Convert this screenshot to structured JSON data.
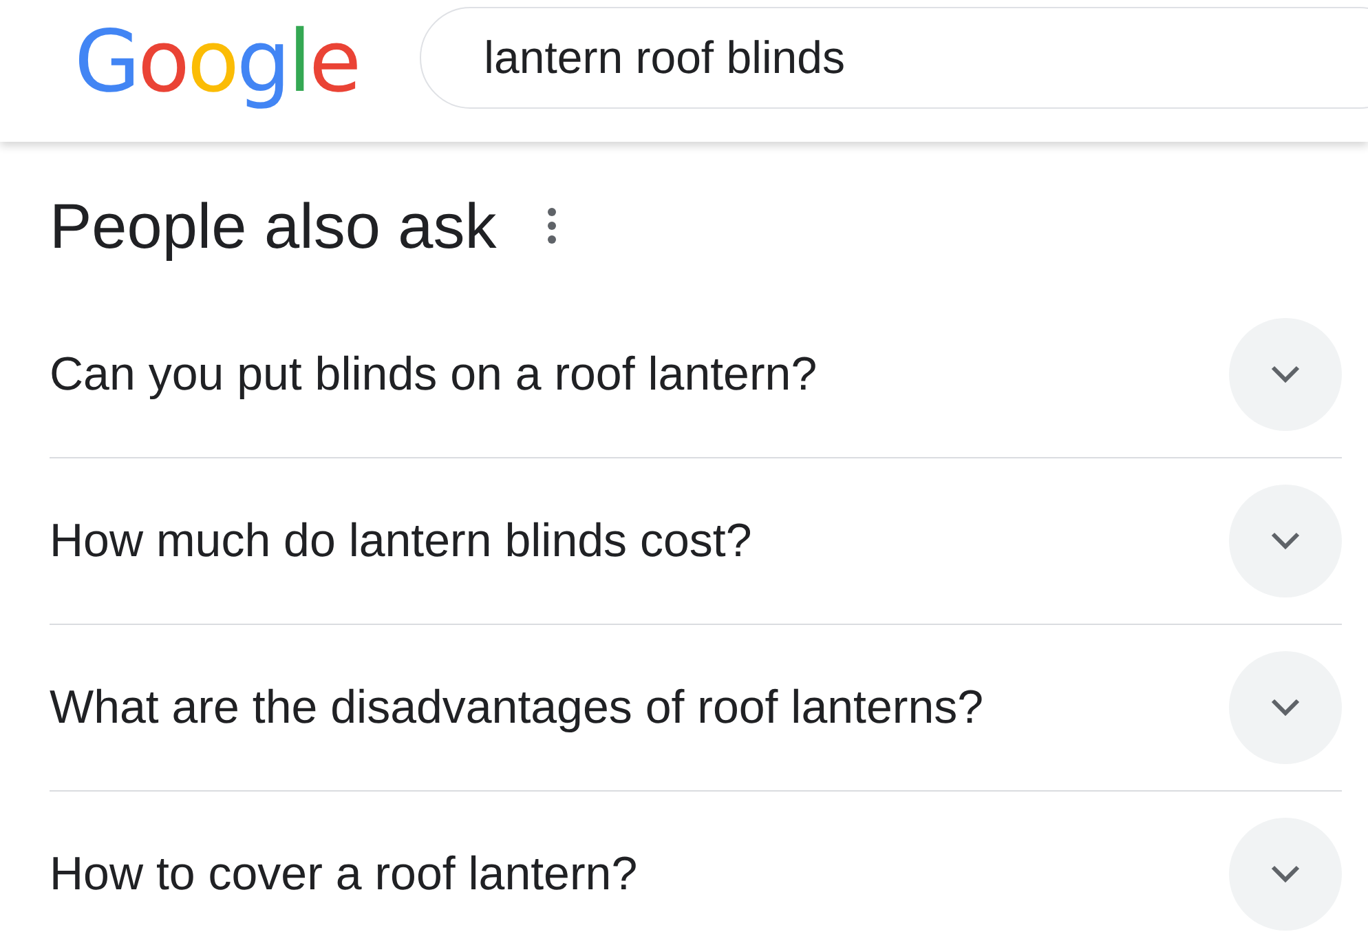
{
  "header": {
    "logo": "Google",
    "search": {
      "value": "lantern roof blinds"
    }
  },
  "people_also_ask": {
    "title": "People also ask",
    "questions": [
      {
        "text": "Can you put blinds on a roof lantern?",
        "expanded": false
      },
      {
        "text": "How much do lantern blinds cost?",
        "expanded": false
      },
      {
        "text": "What are the disadvantages of roof lanterns?",
        "expanded": false
      },
      {
        "text": "How to cover a roof lantern?",
        "expanded": false
      }
    ]
  }
}
